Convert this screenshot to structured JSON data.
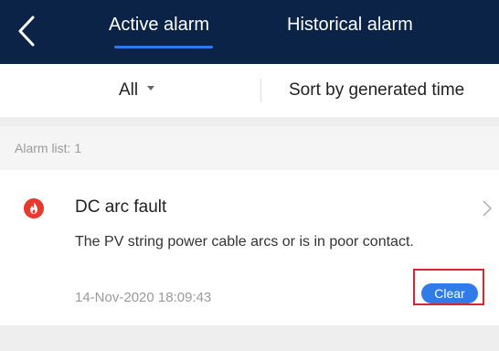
{
  "header": {
    "tabs": [
      {
        "label": "Active alarm",
        "active": true
      },
      {
        "label": "Historical alarm",
        "active": false
      }
    ]
  },
  "filters": {
    "level_selected": "All",
    "sort_label": "Sort by generated time"
  },
  "alarm_list": {
    "count_label": "Alarm list: 1",
    "items": [
      {
        "icon": "fire-icon",
        "title": "DC arc fault",
        "description": "The PV string power cable arcs or is in poor contact.",
        "time": "14-Nov-2020 18:09:43",
        "clear_label": "Clear"
      }
    ]
  },
  "colors": {
    "header_bg": "#0b2346",
    "accent": "#2f7bea",
    "alarm_icon": "#e8392f",
    "highlight_box": "#d8262b"
  }
}
